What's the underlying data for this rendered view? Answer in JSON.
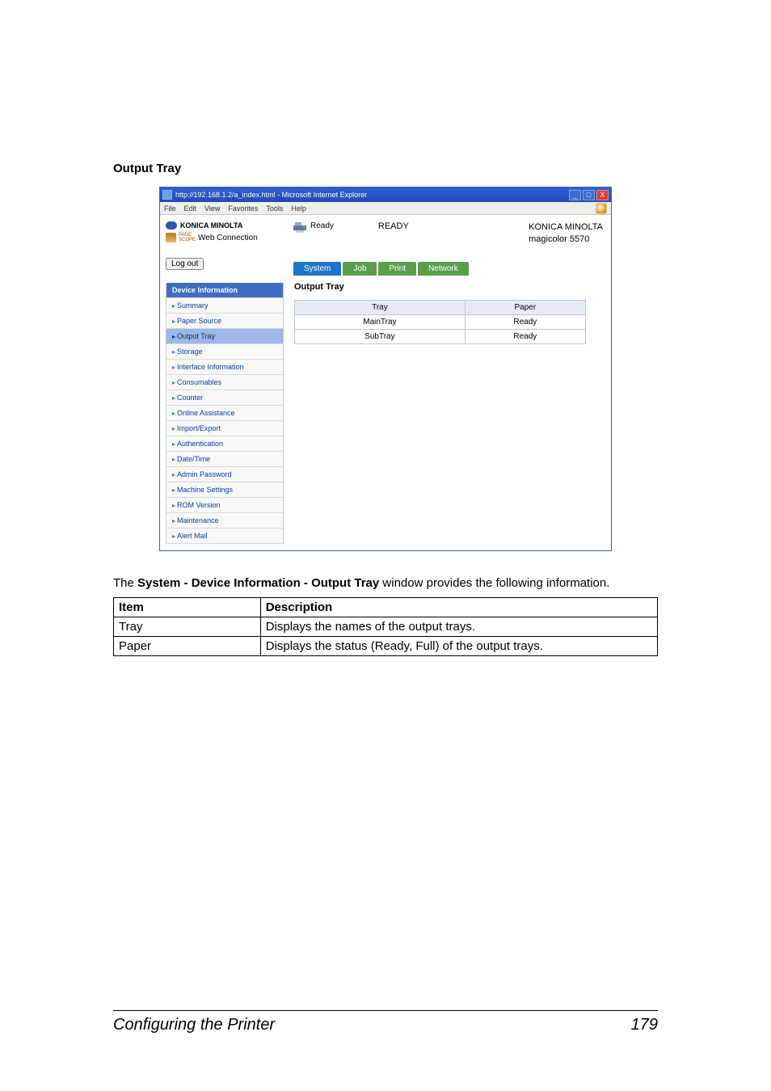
{
  "page": {
    "heading": "Output Tray",
    "desc_pre": "The ",
    "desc_bold": "System - Device Information - Output Tray",
    "desc_post": " window provides the following information."
  },
  "browser": {
    "title": "http://192.168.1.2/a_index.html - Microsoft Internet Explorer",
    "menus": [
      "File",
      "Edit",
      "View",
      "Favorites",
      "Tools",
      "Help"
    ],
    "win_btns": {
      "min": "_",
      "max": "□",
      "close": "X"
    }
  },
  "header": {
    "brand": "KONICA MINOLTA",
    "pagescope1": "PAGE",
    "pagescope2": "SCOPE",
    "webconn": "Web Connection",
    "ready_label": "Ready",
    "ready_value": "READY",
    "model_brand": "KONICA MINOLTA",
    "model_name": "magicolor 5570",
    "logout": "Log out"
  },
  "tabs": [
    "System",
    "Job",
    "Print",
    "Network"
  ],
  "sidebar": {
    "header": "Device Information",
    "items": [
      {
        "label": "Summary",
        "active": false
      },
      {
        "label": "Paper Source",
        "active": false
      },
      {
        "label": "Output Tray",
        "active": true
      },
      {
        "label": "Storage",
        "active": false
      },
      {
        "label": "Interface Information",
        "active": false
      },
      {
        "label": "Consumables",
        "active": false
      },
      {
        "label": "Counter",
        "active": false
      },
      {
        "label": "Online Assistance",
        "active": false
      },
      {
        "label": "Import/Export",
        "active": false
      },
      {
        "label": "Authentication",
        "active": false
      },
      {
        "label": "Date/Time",
        "active": false
      },
      {
        "label": "Admin Password",
        "active": false
      },
      {
        "label": "Machine Settings",
        "active": false
      },
      {
        "label": "ROM Version",
        "active": false
      },
      {
        "label": "Maintenance",
        "active": false
      },
      {
        "label": "Alert Mail",
        "active": false
      }
    ]
  },
  "panel": {
    "title": "Output Tray",
    "cols": [
      "Tray",
      "Paper"
    ],
    "rows": [
      {
        "tray": "MainTray",
        "paper": "Ready"
      },
      {
        "tray": "SubTray",
        "paper": "Ready"
      }
    ]
  },
  "doc_table": {
    "head": [
      "Item",
      "Description"
    ],
    "rows": [
      {
        "item": "Tray",
        "desc": "Displays the names of the output trays."
      },
      {
        "item": "Paper",
        "desc": "Displays the status (Ready, Full) of the output trays."
      }
    ]
  },
  "footer": {
    "left": "Configuring the Printer",
    "right": "179"
  }
}
